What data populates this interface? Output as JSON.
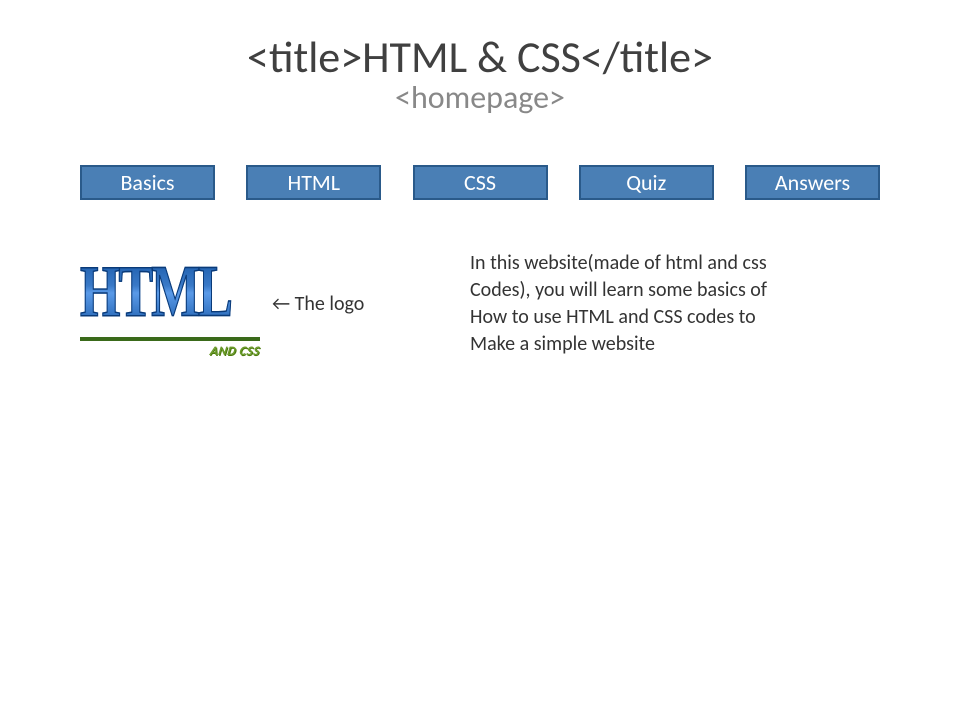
{
  "header": {
    "title": "<title>HTML & CSS</title>",
    "subtitle": "<homepage>"
  },
  "nav": {
    "items": [
      {
        "label": "Basics"
      },
      {
        "label": "HTML"
      },
      {
        "label": "CSS"
      },
      {
        "label": "Quiz"
      },
      {
        "label": "Answers"
      }
    ]
  },
  "logo": {
    "main": "HTML",
    "sub": "AND CSS",
    "note": "← The logo"
  },
  "intro": {
    "line1": "In this website(made of html and css",
    "line2": "Codes), you will learn some basics of",
    "line3": "How to use HTML and CSS codes to",
    "line4": "Make a simple website"
  }
}
